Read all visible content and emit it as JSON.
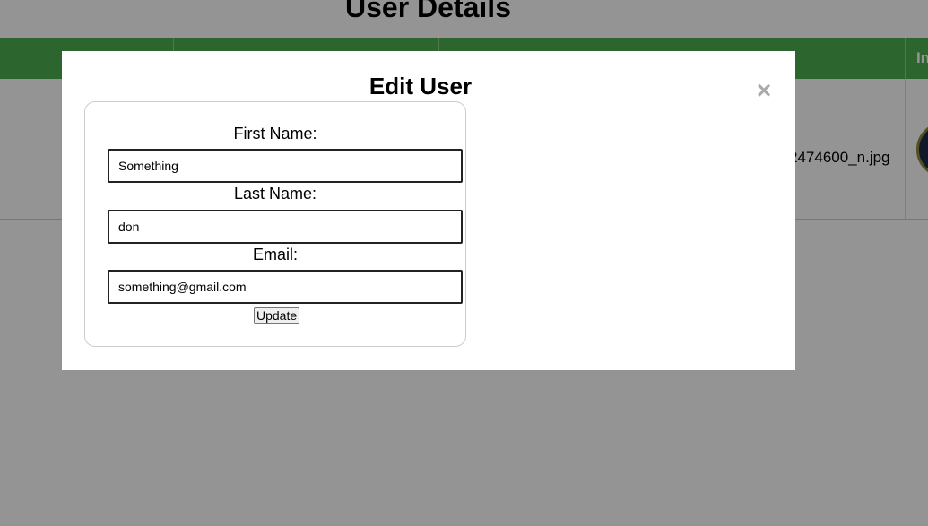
{
  "page": {
    "title": "User Details"
  },
  "table": {
    "header_partial": "In",
    "row": {
      "image_file": "2474600_n.jpg"
    }
  },
  "modal": {
    "title": "Edit User",
    "close_symbol": "×",
    "form": {
      "first_name_label": "First Name:",
      "first_name_value": "Something",
      "last_name_label": "Last Name:",
      "last_name_value": "don",
      "email_label": "Email:",
      "email_value": "something@gmail.com",
      "update_label": "Update"
    }
  },
  "colors": {
    "header_green": "#4caf50",
    "overlay": "rgba(0,0,0,0.42)",
    "close_gray": "#aaaaaa"
  }
}
